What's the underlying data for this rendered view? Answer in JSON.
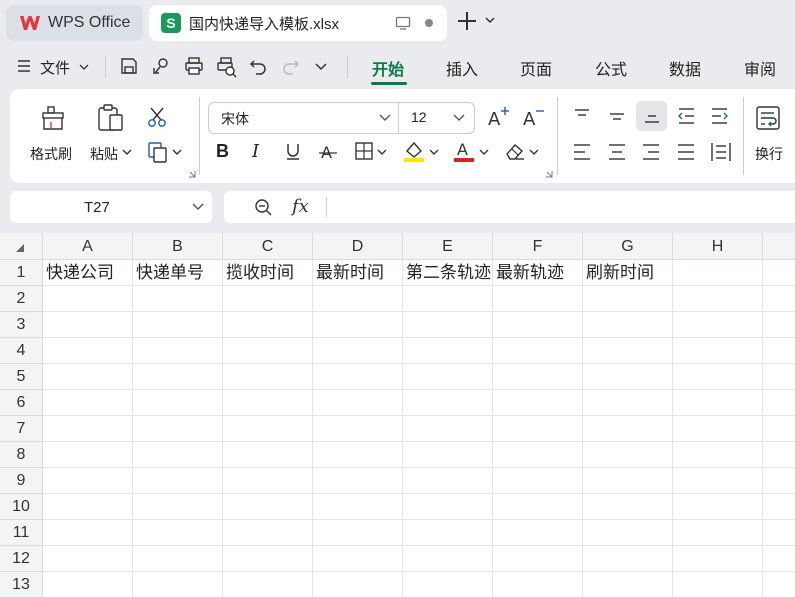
{
  "tabs": {
    "home_label": "WPS Office",
    "doc_label": "国内快递导入模板.xlsx",
    "doc_badge": "S"
  },
  "menu": {
    "file_label": "文件",
    "items": [
      "开始",
      "插入",
      "页面",
      "公式",
      "数据",
      "审阅"
    ],
    "active": "开始"
  },
  "ribbon": {
    "format_painter_label": "格式刷",
    "paste_label": "粘贴",
    "font_name": "宋体",
    "font_size": "12",
    "wrap_label": "换行"
  },
  "formula_bar": {
    "cell_ref": "T27",
    "fx_label": "fx",
    "formula": ""
  },
  "sheet": {
    "columns": [
      "A",
      "B",
      "C",
      "D",
      "E",
      "F",
      "G",
      "H"
    ],
    "rows": [
      "1",
      "2",
      "3",
      "4",
      "5",
      "6",
      "7",
      "8",
      "9",
      "10",
      "11",
      "12",
      "13"
    ],
    "header_row": [
      "快递公司",
      "快递单号",
      "揽收时间",
      "最新时间",
      "第二条轨迹",
      "最新轨迹",
      "刷新时间",
      ""
    ]
  },
  "colors": {
    "accent": "#0a7d46",
    "sheet_badge": "#1a9a5a",
    "wps_logo": "#e8323c",
    "highlight": "#ffe600",
    "font_color": "#e02020"
  }
}
